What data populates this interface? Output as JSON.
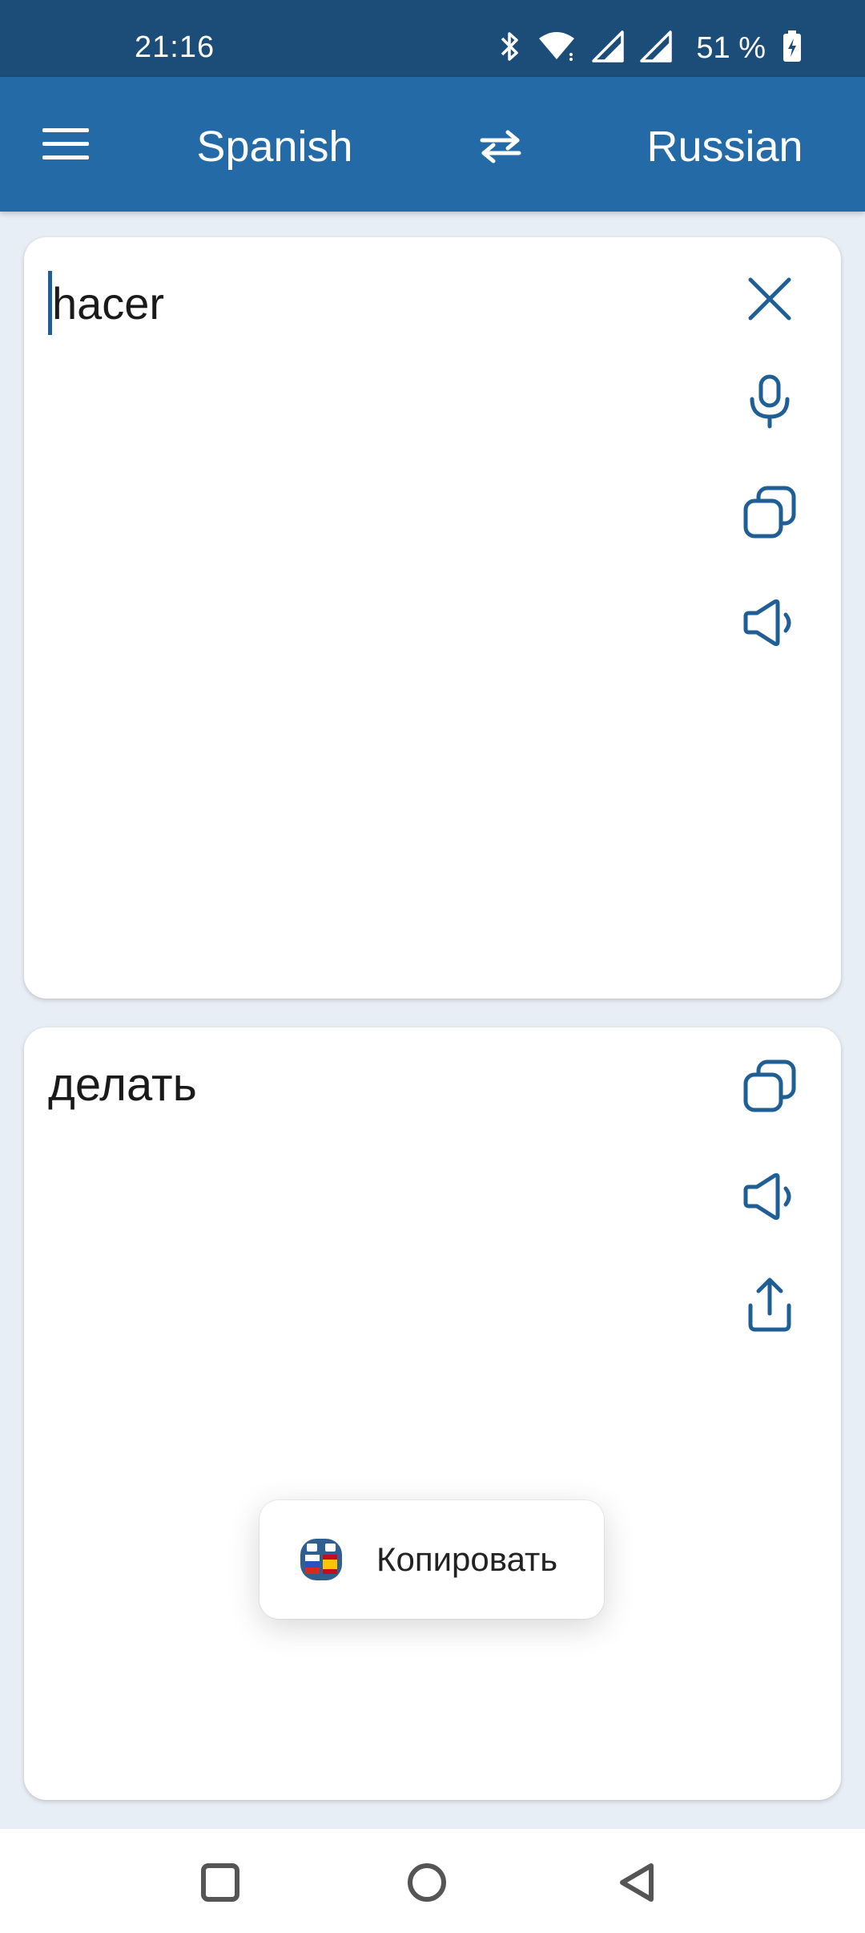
{
  "status_bar": {
    "time": "21:16",
    "battery_text": "51 %",
    "icons": [
      "bluetooth-icon",
      "wifi-icon",
      "signal-icon",
      "signal-icon",
      "battery-charging-icon"
    ]
  },
  "app_bar": {
    "source_language": "Spanish",
    "target_language": "Russian",
    "menu_icon": "menu-icon",
    "swap_icon": "swap-languages-icon"
  },
  "input_card": {
    "text": "hacer",
    "actions": [
      "clear-icon",
      "microphone-icon",
      "copy-icon",
      "speaker-icon"
    ]
  },
  "output_card": {
    "text": "делать",
    "actions": [
      "copy-icon",
      "speaker-icon",
      "share-icon"
    ]
  },
  "toast": {
    "text": "Копировать"
  },
  "colors": {
    "status_bar": "#1c4c78",
    "app_bar": "#246aa6",
    "icon_blue": "#1f5f95",
    "background": "#e8eef5"
  }
}
